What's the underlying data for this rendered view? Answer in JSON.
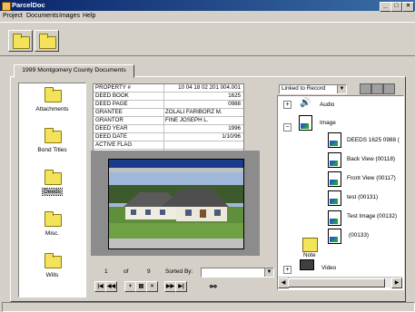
{
  "app": {
    "title": "ParcelDoc"
  },
  "menu": [
    "Project",
    "Documents",
    "Images",
    "Help"
  ],
  "tab": {
    "label": "1999 Montgomery County Documents"
  },
  "folders": [
    {
      "label": "Attachments"
    },
    {
      "label": "Bond Titles"
    },
    {
      "label": "Deeds"
    },
    {
      "label": "Misc."
    },
    {
      "label": "Wills"
    }
  ],
  "record": {
    "rows": [
      {
        "key": "PROPERTY #",
        "value": "10 04 18 02 201 004.001",
        "align": "right"
      },
      {
        "key": "DEED BOOK",
        "value": "1625",
        "align": "right"
      },
      {
        "key": "DEED PAGE",
        "value": "0988",
        "align": "right"
      },
      {
        "key": "GRANTEE",
        "value": "ZOLALI FARIBORZ M.",
        "align": "left"
      },
      {
        "key": "GRANTOR",
        "value": "FINE JOSEPH L.",
        "align": "left"
      },
      {
        "key": "DEED YEAR",
        "value": "1996",
        "align": "right"
      },
      {
        "key": "DEED DATE",
        "value": "1/10/96",
        "align": "right"
      },
      {
        "key": "ACTIVE FLAG",
        "value": "",
        "align": "right"
      }
    ]
  },
  "nav": {
    "current": "1",
    "of": "of",
    "total": "9",
    "sorted_by": "Sorted By:",
    "sort_value": ""
  },
  "linked": {
    "dropdown": "Linked to Record"
  },
  "tree": {
    "audio": "Audio",
    "image": "Image",
    "items": [
      "DEEDS 1625 0988 (",
      "Back View (00118)",
      "Front View (00117)",
      "test (00131)",
      "Test Image (00132)",
      "(00133)"
    ],
    "note": "Note",
    "video": "Video"
  },
  "colors": {
    "titlebar": "#0a246a",
    "folder": "#f2e35a",
    "face": "#d4d0c8"
  }
}
